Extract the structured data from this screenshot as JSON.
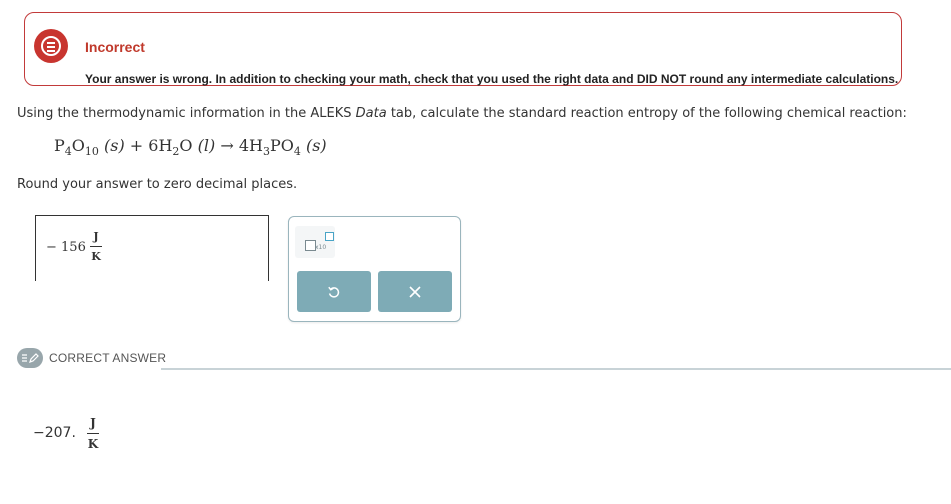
{
  "feedback": {
    "title": "Incorrect",
    "message": "Your answer is wrong. In addition to checking your math, check that you used the right data and DID NOT round any intermediate calculations.",
    "color": "#c0392b"
  },
  "question": {
    "prefix": "Using the thermodynamic information in the ALEKS ",
    "data_word": "Data",
    "suffix": " tab, calculate the standard reaction entropy of the following chemical reaction:",
    "rounding": "Round your answer to zero decimal places."
  },
  "equation": {
    "r1": "P",
    "r1_s1": "4",
    "r1_m": "O",
    "r1_s2": "10",
    "r1_phase": "(s)",
    "plus": "+",
    "r2_coef": "6H",
    "r2_s": "2",
    "r2_m": "O",
    "r2_phase": "(l)",
    "arrow": "→",
    "p_coef": "4H",
    "p_s1": "3",
    "p_m": "PO",
    "p_s2": "4",
    "p_phase": "(s)"
  },
  "answer": {
    "value": "− 156",
    "unit_num": "J",
    "unit_den": "K"
  },
  "tools": {
    "x10_label": "x10",
    "undo_icon": "undo-icon",
    "clear_icon": "close-icon"
  },
  "correct": {
    "label": "CORRECT ANSWER",
    "value": "−207.",
    "unit_num": "J",
    "unit_den": "K"
  },
  "colors": {
    "button": "#7eabb6",
    "panel_border": "#9ab5bd",
    "error_red": "#c8352f"
  }
}
